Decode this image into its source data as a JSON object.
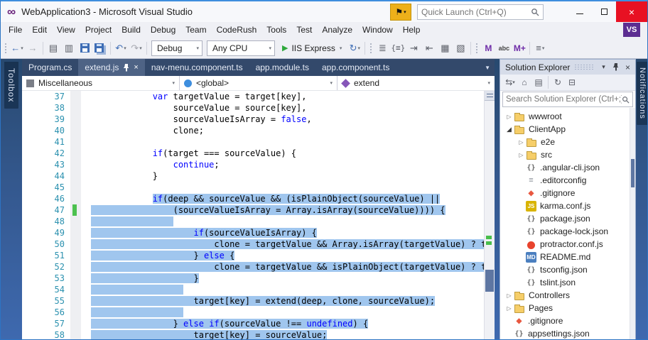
{
  "titlebar": {
    "title": "WebApplication3 - Microsoft Visual Studio",
    "quick_launch_placeholder": "Quick Launch (Ctrl+Q)"
  },
  "menubar": {
    "items": [
      "File",
      "Edit",
      "View",
      "Project",
      "Build",
      "Debug",
      "Team",
      "CodeRush",
      "Tools",
      "Test",
      "Analyze",
      "Window",
      "Help"
    ],
    "account_badge": "VS"
  },
  "toolbar": {
    "configuration": "Debug",
    "platform": "Any CPU",
    "run_target": "IIS Express",
    "letter_icons": [
      "M",
      "abc",
      "M+"
    ]
  },
  "side_tabs": {
    "left": "Toolbox",
    "right": "Notifications"
  },
  "editor": {
    "tabs": [
      {
        "label": "Program.cs",
        "active": false
      },
      {
        "label": "extend.js",
        "active": true
      },
      {
        "label": "nav-menu.component.ts",
        "active": false
      },
      {
        "label": "app.module.ts",
        "active": false
      },
      {
        "label": "app.component.ts",
        "active": false
      }
    ],
    "navbar": {
      "project": "Miscellaneous",
      "scope": "<global>",
      "member": "extend"
    },
    "code": {
      "first_line": 37,
      "lines": [
        {
          "n": 37,
          "seg": [
            [
              "            "
            ],
            [
              "var",
              "k"
            ],
            [
              " targetValue = target[key],"
            ]
          ]
        },
        {
          "n": 38,
          "seg": [
            [
              "                sourceValue = source[key],"
            ]
          ]
        },
        {
          "n": 39,
          "seg": [
            [
              "                sourceValueIsArray = "
            ],
            [
              "false",
              "k"
            ],
            [
              ","
            ]
          ]
        },
        {
          "n": 40,
          "seg": [
            [
              "                clone;"
            ]
          ]
        },
        {
          "n": 41,
          "seg": []
        },
        {
          "n": 42,
          "seg": [
            [
              "            "
            ],
            [
              "if",
              "k"
            ],
            [
              "(target === sourceValue) {"
            ]
          ]
        },
        {
          "n": 43,
          "seg": [
            [
              "                "
            ],
            [
              "continue",
              "k"
            ],
            [
              ";"
            ]
          ]
        },
        {
          "n": 44,
          "seg": [
            [
              "            }"
            ]
          ]
        },
        {
          "n": 45,
          "seg": []
        },
        {
          "n": 46,
          "seg": [
            [
              "            "
            ],
            [
              "if",
              "ks"
            ],
            [
              "(deep && sourceValue && (isPlainObject(sourceValue) ||",
              "s"
            ]
          ]
        },
        {
          "n": 47,
          "chg": true,
          "seg": [
            [
              "                (sourceValueIsArray = Array.isArray(sourceValue)))) {",
              "s"
            ]
          ]
        },
        {
          "n": 48,
          "seg": [
            [
              "                ",
              "s"
            ]
          ]
        },
        {
          "n": 49,
          "seg": [
            [
              "                    ",
              "s"
            ],
            [
              "if",
              "ks"
            ],
            [
              "(sourceValueIsArray) {",
              "s"
            ]
          ]
        },
        {
          "n": 50,
          "seg": [
            [
              "                        clone = targetValue && Array.isArray(targetValue) ? targetValue : [];",
              "s"
            ]
          ]
        },
        {
          "n": 51,
          "seg": [
            [
              "                    } ",
              "s"
            ],
            [
              "else",
              "ks"
            ],
            [
              " {",
              "s"
            ]
          ]
        },
        {
          "n": 52,
          "seg": [
            [
              "                        clone = targetValue && isPlainObject(targetValue) ? targetValue : {};",
              "s"
            ]
          ]
        },
        {
          "n": 53,
          "seg": [
            [
              "                    }",
              "s"
            ]
          ]
        },
        {
          "n": 54,
          "seg": [
            [
              "                  ",
              "s"
            ]
          ]
        },
        {
          "n": 55,
          "seg": [
            [
              "                    target[key] = extend(deep, clone, sourceValue);",
              "s"
            ]
          ]
        },
        {
          "n": 56,
          "seg": [
            [
              "                  ",
              "s"
            ]
          ]
        },
        {
          "n": 57,
          "seg": [
            [
              "                } ",
              "s"
            ],
            [
              "else",
              "ks"
            ],
            [
              " ",
              "s"
            ],
            [
              "if",
              "ks"
            ],
            [
              "(sourceValue !== ",
              "s"
            ],
            [
              "undefined",
              "ks"
            ],
            [
              ") {",
              "s"
            ]
          ]
        },
        {
          "n": 58,
          "seg": [
            [
              "                    target[key] = sourceValue;",
              "s"
            ]
          ]
        }
      ]
    }
  },
  "solution_explorer": {
    "title": "Solution Explorer",
    "search_placeholder": "Search Solution Explorer (Ctrl+;)",
    "tree": [
      {
        "label": "wwwroot",
        "level": 1,
        "icon": "folder",
        "arrow": "collapsed"
      },
      {
        "label": "ClientApp",
        "level": 1,
        "icon": "folder",
        "arrow": "expanded"
      },
      {
        "label": "e2e",
        "level": 2,
        "icon": "folder",
        "arrow": "collapsed"
      },
      {
        "label": "src",
        "level": 2,
        "icon": "folder",
        "arrow": "collapsed"
      },
      {
        "label": ".angular-cli.json",
        "level": 2,
        "icon": "json"
      },
      {
        "label": ".editorconfig",
        "level": 2,
        "icon": "cfg"
      },
      {
        "label": ".gitignore",
        "level": 2,
        "icon": "git"
      },
      {
        "label": "karma.conf.js",
        "level": 2,
        "icon": "js"
      },
      {
        "label": "package.json",
        "level": 2,
        "icon": "json"
      },
      {
        "label": "package-lock.json",
        "level": 2,
        "icon": "json"
      },
      {
        "label": "protractor.conf.js",
        "level": 2,
        "icon": "prot"
      },
      {
        "label": "README.md",
        "level": 2,
        "icon": "md"
      },
      {
        "label": "tsconfig.json",
        "level": 2,
        "icon": "json"
      },
      {
        "label": "tslint.json",
        "level": 2,
        "icon": "json"
      },
      {
        "label": "Controllers",
        "level": 1,
        "icon": "folder",
        "arrow": "collapsed"
      },
      {
        "label": "Pages",
        "level": 1,
        "icon": "folder",
        "arrow": "collapsed"
      },
      {
        "label": ".gitignore",
        "level": 1,
        "icon": "git"
      },
      {
        "label": "appsettings.json",
        "level": 1,
        "icon": "json"
      }
    ]
  },
  "colors": {
    "accent_blue": "#2D74C4",
    "selection": "#A0C6EE",
    "keyword": "#0000FF",
    "line_number": "#2B91AF",
    "change_bar_green": "#4CC14F",
    "active_tab": "#4E6385",
    "tab_strip": "#33496B",
    "close_button_red": "#E81123",
    "feedback_gold": "#EDB01A",
    "account_badge_purple": "#5C2D91"
  }
}
